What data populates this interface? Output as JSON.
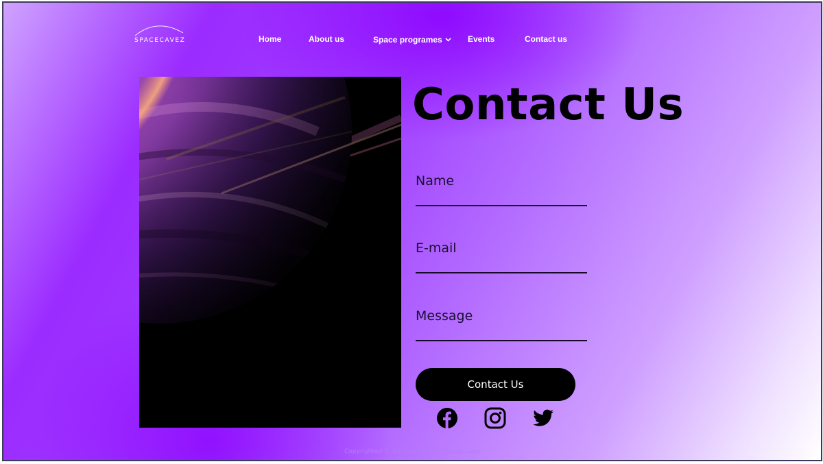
{
  "brand": {
    "name": "SPACECAVEZ"
  },
  "nav": {
    "items": [
      {
        "label": "Home"
      },
      {
        "label": "About us"
      },
      {
        "label": "Space programes",
        "has_dropdown": true
      },
      {
        "label": "Events"
      },
      {
        "label": "Contact us"
      }
    ]
  },
  "main": {
    "title": "Contact Us",
    "image_icon": "planet-image",
    "form": {
      "name_label": "Name",
      "email_label": "E-mail",
      "message_label": "Message",
      "submit_label": "Contact Us"
    },
    "social": [
      {
        "icon": "facebook-icon"
      },
      {
        "icon": "instagram-icon"
      },
      {
        "icon": "twitter-icon"
      }
    ]
  },
  "footer": {
    "text": "Copyrighted © 2023 upload by SpaceCavez"
  },
  "colors": {
    "accent": "#8c00ff",
    "text_dark": "#000000",
    "nav_text": "#ffffff",
    "button_bg": "#000000"
  }
}
